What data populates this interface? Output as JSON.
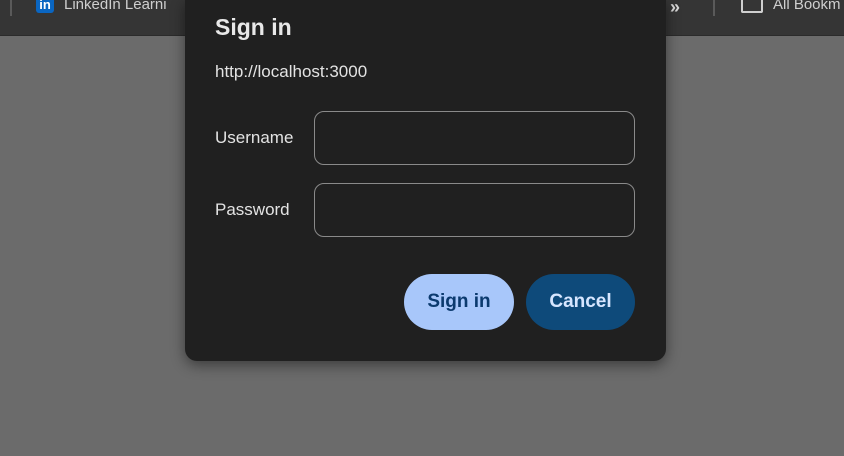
{
  "bookmarks_bar": {
    "items": [
      {
        "label": "LinkedIn Learni",
        "icon": "linkedin-icon",
        "icon_text": "in"
      },
      {
        "label": "All Bookm",
        "icon": "folder-icon"
      }
    ],
    "overflow_glyph": "»"
  },
  "dialog": {
    "title": "Sign in",
    "origin": "http://localhost:3000",
    "fields": [
      {
        "label": "Username",
        "value": "",
        "type": "text"
      },
      {
        "label": "Password",
        "value": "",
        "type": "password"
      }
    ],
    "buttons": {
      "sign_in": "Sign in",
      "cancel": "Cancel"
    }
  },
  "colors": {
    "backdrop": "#6b6b6b",
    "dialog_bg": "#202020",
    "primary_button": "#a8c7fa",
    "secondary_button": "#0e4a7a"
  }
}
